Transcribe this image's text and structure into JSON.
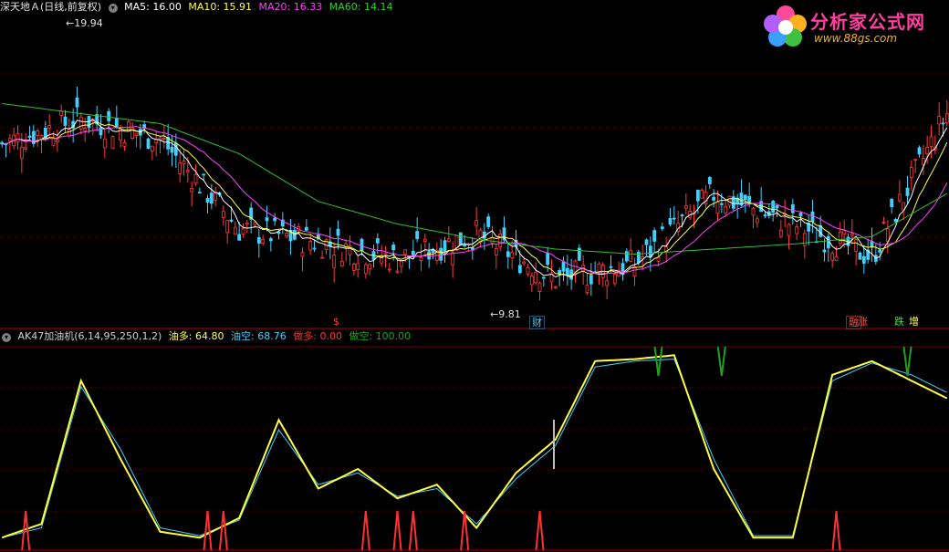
{
  "header": {
    "title": "深天地Ａ(日线,前复权)",
    "ma5_label": "MA5:",
    "ma5_value": "16.00",
    "ma10_label": "MA10:",
    "ma10_value": "15.91",
    "ma20_label": "MA20:",
    "ma20_value": "16.33",
    "ma60_label": "MA60:",
    "ma60_value": "14.14"
  },
  "indicator_header": {
    "title": "AK47加油机(6,14,95,250,1,2)",
    "l1_label": "油多:",
    "l1_value": "64.80",
    "l2_label": "油空:",
    "l2_value": "68.76",
    "l3_label": "做多:",
    "l3_value": "0.00",
    "l4_label": "做空:",
    "l4_value": "100.00"
  },
  "logo": {
    "name": "分析家公式网",
    "url": "www.88gs.com"
  },
  "price_annotations": {
    "high": "19.94",
    "low": "9.81"
  },
  "markers": {
    "s": "$",
    "cai": "财",
    "rong": "融",
    "zhang": "涨",
    "die": "跌",
    "zeng": "增"
  },
  "colors": {
    "up": "#ff3b3b",
    "down": "#40d0ff",
    "ma5": "#ffffff",
    "ma10": "#ffff40",
    "ma20": "#ff40ff",
    "ma60": "#30c030",
    "grid": "#6a0000",
    "you_duo": "#ffff40",
    "you_kong": "#40d0ff",
    "zuo_duo": "#ff3030",
    "zuo_kong": "#20a020"
  },
  "chart_data": [
    {
      "type": "candlestick",
      "title": "深天地Ａ(日线,前复权)",
      "series": [
        {
          "name": "MA5",
          "last": 16.0
        },
        {
          "name": "MA10",
          "last": 15.91
        },
        {
          "name": "MA20",
          "last": 16.33
        },
        {
          "name": "MA60",
          "last": 14.14
        }
      ],
      "x": [
        0,
        20,
        40,
        60,
        80,
        100,
        120,
        140,
        160,
        180,
        200,
        220,
        240
      ],
      "close": [
        16.0,
        17.0,
        16.2,
        12.6,
        12.1,
        11.4,
        12.4,
        10.6,
        11.2,
        14.0,
        12.8,
        11.5,
        17.5
      ],
      "ma60": [
        17.6,
        17.2,
        16.8,
        15.6,
        13.7,
        12.8,
        12.2,
        11.8,
        11.6,
        11.8,
        12.0,
        12.3,
        14.1
      ],
      "high_mark": 19.94,
      "low_mark": 9.81
    },
    {
      "type": "line",
      "title": "AK47加油机(6,14,95,250,1,2)",
      "ylim": [
        0,
        100
      ],
      "x": [
        0,
        10,
        20,
        30,
        40,
        50,
        60,
        70,
        80,
        90,
        100,
        110,
        120,
        130,
        140,
        150,
        160,
        170,
        180,
        190,
        200,
        210,
        220,
        230,
        240
      ],
      "series": [
        {
          "name": "油多",
          "values": [
            5,
            12,
            85,
            45,
            8,
            5,
            15,
            65,
            30,
            40,
            25,
            32,
            10,
            38,
            55,
            95,
            96,
            98,
            40,
            5,
            5,
            88,
            95,
            85,
            75
          ]
        },
        {
          "name": "油空",
          "values": [
            5,
            10,
            82,
            50,
            10,
            6,
            14,
            60,
            32,
            38,
            26,
            30,
            12,
            35,
            52,
            92,
            95,
            96,
            45,
            6,
            6,
            85,
            94,
            88,
            78
          ]
        }
      ],
      "zuo_duo_signal_x": [
        6,
        52,
        56,
        92,
        100,
        104,
        117,
        136,
        211
      ],
      "zuo_kong_signal_x": [
        166,
        182,
        229
      ],
      "last": {
        "油多": 64.8,
        "油空": 68.76,
        "做多": 0.0,
        "做空": 100.0
      }
    }
  ]
}
